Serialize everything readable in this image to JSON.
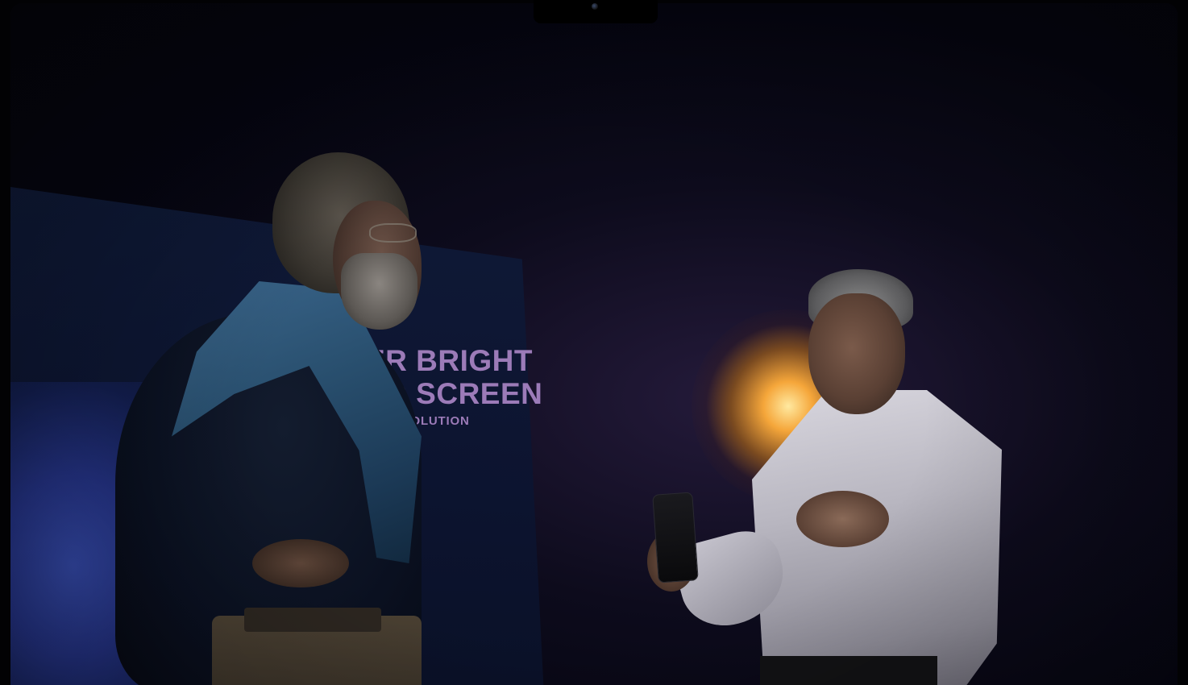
{
  "photo": {
    "scene": "stage-presentation",
    "screen_text": {
      "line1": "ER BRIGHT",
      "line2": "ED SCREEN",
      "line3": "60 RESOLUTION"
    },
    "colors": {
      "background": "#050510",
      "screen_text": "#9c7bb8",
      "spotlight": "#f5a63a"
    }
  }
}
